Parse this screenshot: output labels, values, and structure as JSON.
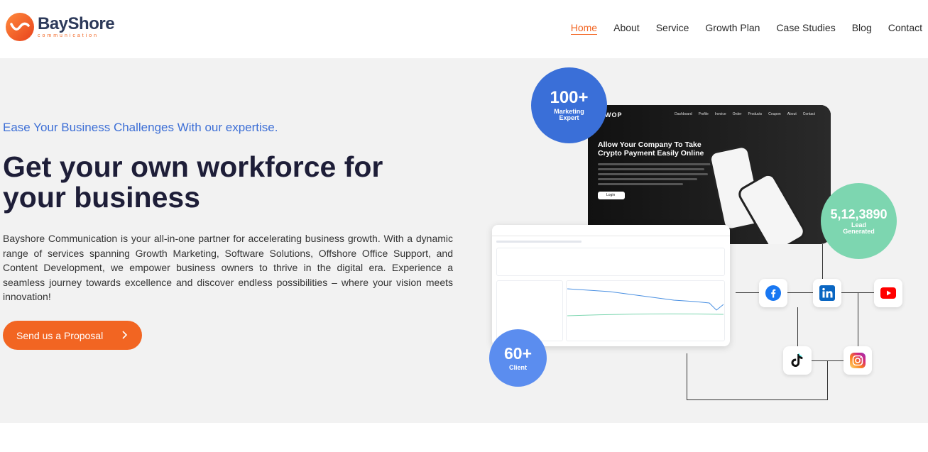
{
  "brand": {
    "name": "BayShore",
    "subtitle": "communication",
    "colors": {
      "orange": "#f26522",
      "navy": "#2d3a5a",
      "blue": "#3a6fd8",
      "green": "#7dd6b0"
    }
  },
  "nav": {
    "items": [
      {
        "label": "Home",
        "active": true
      },
      {
        "label": "About"
      },
      {
        "label": "Service"
      },
      {
        "label": "Growth Plan"
      },
      {
        "label": "Case Studies"
      },
      {
        "label": "Blog"
      },
      {
        "label": "Contact"
      }
    ]
  },
  "hero": {
    "tagline": "Ease Your Business Challenges With our expertise.",
    "headline": "Get your own workforce for your business",
    "description": "Bayshore Communication is your all-in-one partner for accelerating business growth. With a dynamic range of services spanning Growth Marketing, Software Solutions, Offshore Office Support, and Content Development, we empower business owners to thrive in the digital era. Experience a seamless journey towards excellence and discover endless possibilities – where your vision meets innovation!",
    "cta_label": "Send us a Proposal"
  },
  "stats": {
    "marketing": {
      "number": "100+",
      "label": "Marketing Expert"
    },
    "leads": {
      "number": "5,12,3890",
      "label": "Lead Generated"
    },
    "clients": {
      "number": "60+",
      "label": "Client"
    }
  },
  "mock_site": {
    "logo": "WOP",
    "menu": [
      "Dashboard",
      "Profile",
      "Invoice",
      "Order",
      "Products",
      "Coupon",
      "About",
      "Contact"
    ],
    "title": "Allow Your Company To Take Crypto Payment Easily Online",
    "button": "Login"
  },
  "social_icons": [
    "facebook-icon",
    "linkedin-icon",
    "youtube-icon",
    "tiktok-icon",
    "instagram-icon"
  ]
}
